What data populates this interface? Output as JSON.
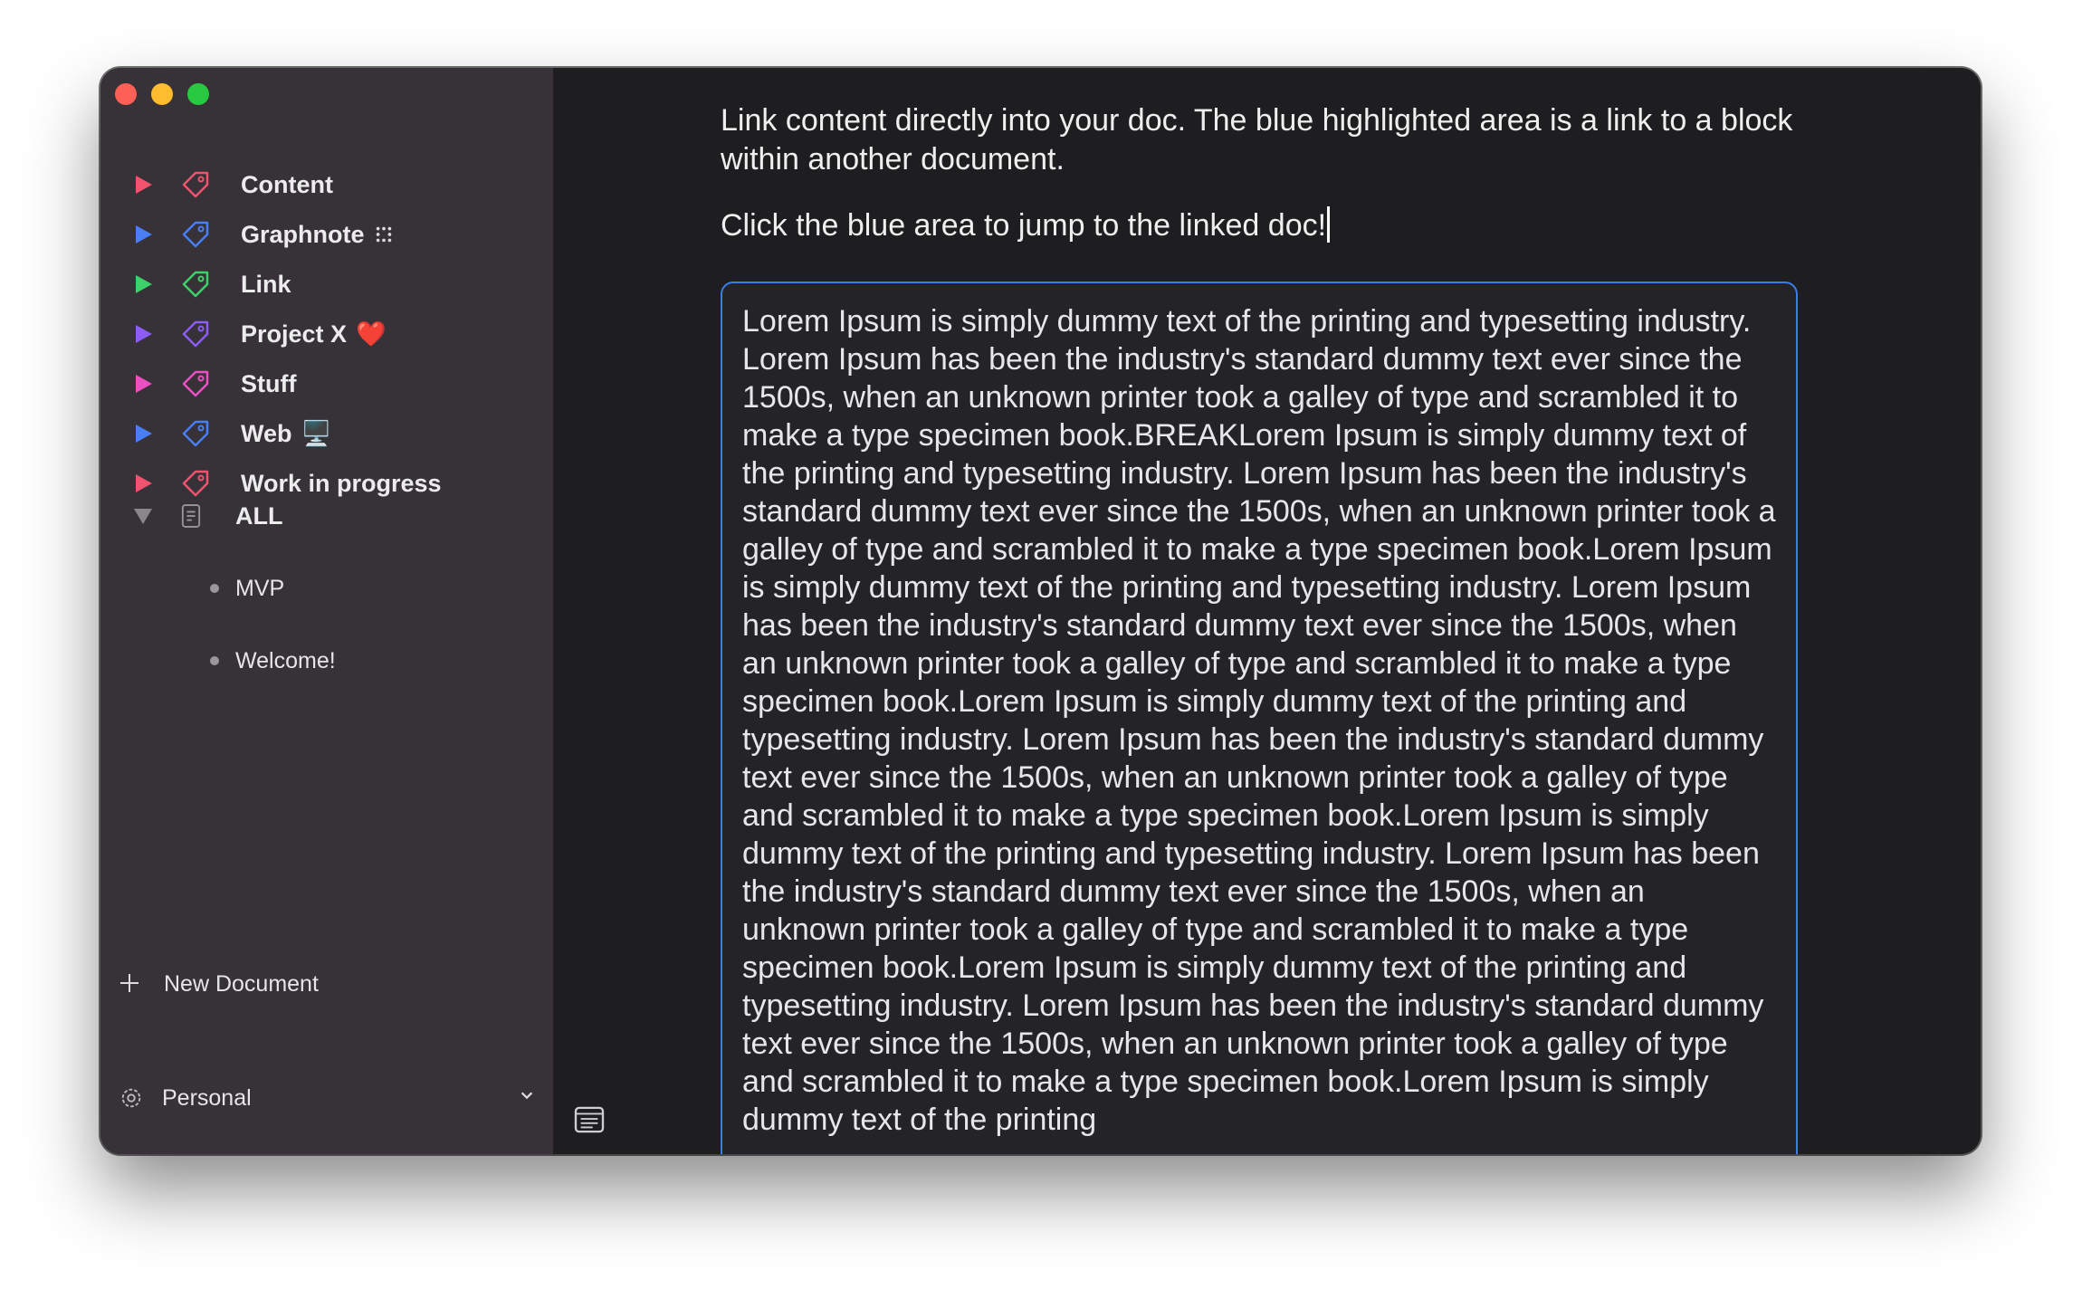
{
  "sidebar": {
    "tags": [
      {
        "label": "Content",
        "emoji": "",
        "color": "#f0536e"
      },
      {
        "label": "Graphnote",
        "emoji": "",
        "color": "#4a7ef5"
      },
      {
        "label": "Link",
        "emoji": "",
        "color": "#3dd16a"
      },
      {
        "label": "Project X",
        "emoji": "❤️",
        "color": "#8b5cf6"
      },
      {
        "label": "Stuff",
        "emoji": "",
        "color": "#ec4fc2"
      },
      {
        "label": "Web",
        "emoji": "🖥️",
        "color": "#4a7ef5"
      },
      {
        "label": "Work in progress",
        "emoji": "",
        "color": "#f0536e"
      }
    ],
    "all_group": {
      "label": "ALL",
      "documents": [
        "MVP",
        "Welcome!"
      ]
    },
    "new_document_label": "New Document",
    "workspace_label": "Personal"
  },
  "editor": {
    "intro_text": "Link content directly into your doc. The blue highlighted area is a link to a block within another document.",
    "instruction_text": "Click the blue area to jump to the linked doc!",
    "linked_block_text": "Lorem Ipsum is simply dummy text of the printing and typesetting industry. Lorem Ipsum has been the industry's standard dummy text ever since the 1500s, when an unknown printer took a galley of type and scrambled it to make a type specimen book.BREAKLorem Ipsum is simply dummy text of the printing and typesetting industry. Lorem Ipsum has been the industry's standard dummy text ever since the 1500s, when an unknown printer took a galley of type and scrambled it to make a type specimen book.Lorem Ipsum is simply dummy text of the printing and typesetting industry. Lorem Ipsum has been the industry's standard dummy text ever since the 1500s, when an unknown printer took a galley of type and scrambled it to make a type specimen book.Lorem Ipsum is simply dummy text of the printing and typesetting industry. Lorem Ipsum has been the industry's standard dummy text ever since the 1500s, when an unknown printer took a galley of type and scrambled it to make a type specimen book.Lorem Ipsum is simply dummy text of the printing and typesetting industry. Lorem Ipsum has been the industry's standard dummy text ever since the 1500s, when an unknown printer took a galley of type and scrambled it to make a type specimen book.Lorem Ipsum is simply dummy text of the printing and typesetting industry. Lorem Ipsum has been the industry's standard dummy text ever since the 1500s, when an unknown printer took a galley of type and scrambled it to make a type specimen book.Lorem Ipsum is simply dummy text of the printing",
    "link_color": "#3a7de8"
  },
  "icons": {
    "sidebar_toggle": "sidebar-toggle-icon",
    "sync_status": "wifi-sync-icon",
    "sync_color": "#2ecc71"
  }
}
